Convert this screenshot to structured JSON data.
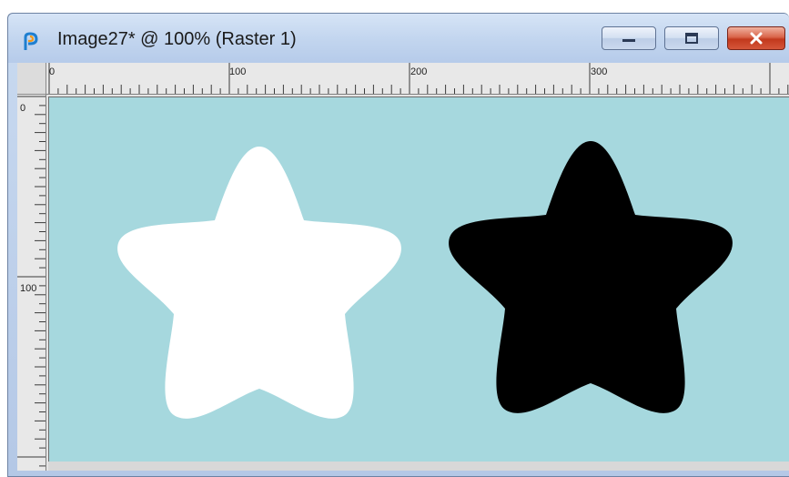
{
  "window": {
    "title": "Image27* @ 100% (Raster 1)",
    "app_icon": "paintshop-pro-icon",
    "controls": {
      "minimize_icon": "minimize-icon",
      "maximize_icon": "maximize-icon",
      "close_icon": "close-icon"
    }
  },
  "rulers": {
    "horizontal_labels": [
      "0",
      "100",
      "200",
      "300"
    ],
    "vertical_labels": [
      "0",
      "100"
    ]
  },
  "canvas": {
    "background_color": "#a6d8de",
    "shapes": [
      {
        "name": "white-star",
        "fill": "#ffffff"
      },
      {
        "name": "black-star",
        "fill": "#000000"
      }
    ]
  },
  "colors": {
    "titlebar": "#c3d6ef",
    "close_button": "#c2391d"
  }
}
